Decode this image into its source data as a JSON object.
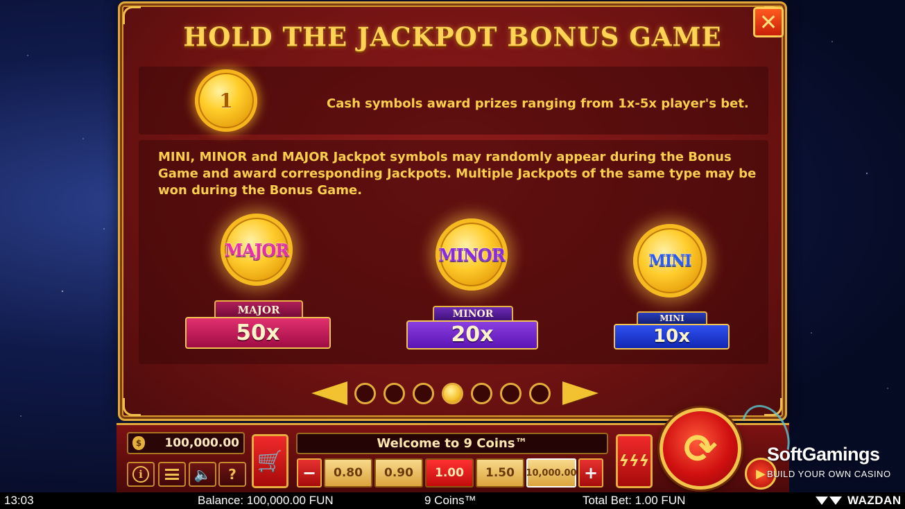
{
  "panel": {
    "title": "HOLD THE JACKPOT BONUS GAME",
    "close_icon": "close-icon",
    "cash_coin_value": "1",
    "cash_text": "Cash symbols award prizes ranging from 1x-5x player's bet.",
    "jackpot_text": "MINI, MINOR and MAJOR Jackpot symbols may randomly appear during the Bonus Game and award corresponding Jackpots. Multiple Jackpots of the same type may be won during the Bonus Game.",
    "jackpots": [
      {
        "coin_label": "MAJOR",
        "tag": "MAJOR",
        "value": "50x",
        "color": "#d81b6a"
      },
      {
        "coin_label": "MINOR",
        "tag": "MINOR",
        "value": "20x",
        "color": "#7b2fd6"
      },
      {
        "coin_label": "MINI",
        "tag": "MINI",
        "value": "10x",
        "color": "#1f3fe0"
      }
    ],
    "pagination": {
      "total_pages": 7,
      "current_page": 4
    }
  },
  "controls": {
    "balance": "100,000.00",
    "welcome": "Welcome to 9  Coins™",
    "bet_minus": "−",
    "bet_plus": "+",
    "bet_options": [
      "0.80",
      "0.90",
      "1.00",
      "1.50",
      "10,000.00"
    ],
    "selected_bet": "1.00",
    "help_label": "?",
    "icons": {
      "balance": "money-bag-icon",
      "info": "info-icon",
      "menu": "menu-icon",
      "sound": "speaker-icon",
      "shop": "cart-icon",
      "auto": "autoplay-icon",
      "spin": "spin-icon",
      "turbo": "play-icon"
    }
  },
  "watermark": {
    "brand": "SoftGamings",
    "tagline": "BUILD YOUR OWN CASINO"
  },
  "status_bar": {
    "time": "13:03",
    "balance": "Balance: 100,000.00 FUN",
    "game": "9 Coins™",
    "total_bet": "Total Bet: 1.00 FUN",
    "provider": "WAZDAN"
  },
  "colors": {
    "panel_bg": "#7a1515",
    "gold": "#f3c231",
    "text_gold": "#fbcf4b"
  }
}
